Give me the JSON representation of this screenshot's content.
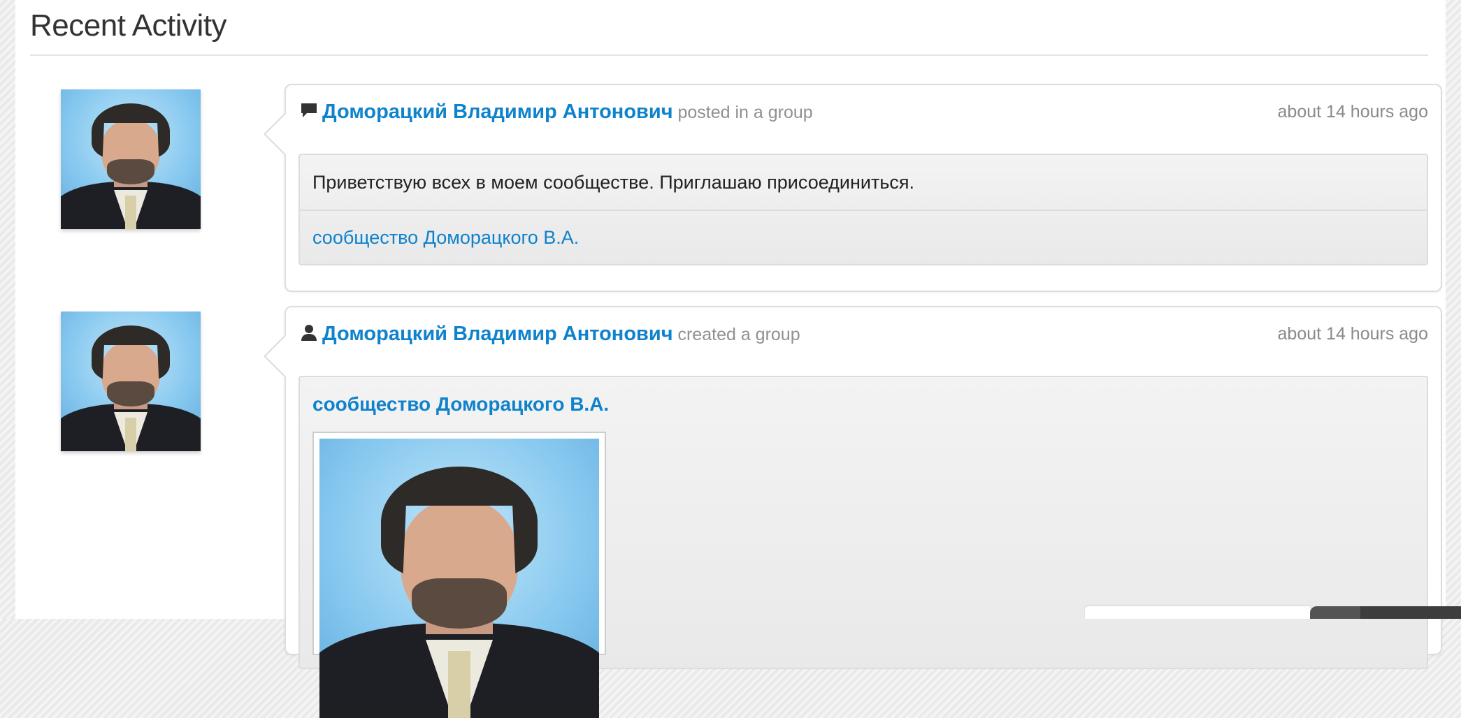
{
  "page": {
    "title": "Recent Activity"
  },
  "activities": [
    {
      "icon": "comment-icon",
      "actor": "Доморацкий Владимир Антонович",
      "verb": "posted in a group",
      "time": "about 14 hours ago",
      "message": "Приветствую всех в моем сообществе. Приглашаю присоединиться.",
      "group_link": "сообщество Доморацкого В.А."
    },
    {
      "icon": "user-icon",
      "actor": "Доморацкий Владимир Антонович",
      "verb": "created a group",
      "time": "about 14 hours ago",
      "group_name": "сообщество Доморацкого В.А."
    }
  ],
  "colors": {
    "link": "#0f82cc",
    "muted": "#909090",
    "border": "#dddddd"
  }
}
